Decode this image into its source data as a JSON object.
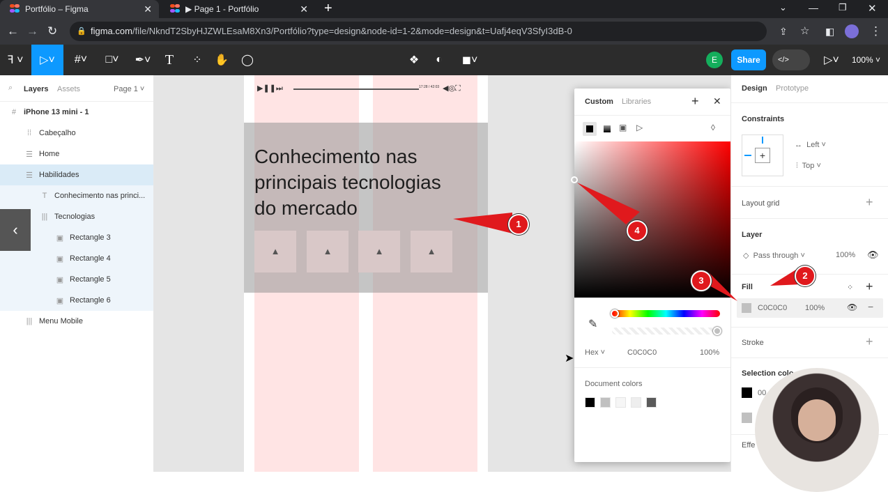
{
  "browser": {
    "tabs": [
      {
        "title": "Portfólio – Figma"
      },
      {
        "title": "▶ Page 1 - Portfólio"
      }
    ],
    "url_host": "figma.com",
    "url_path": "/file/NkndT2SbyHJZWLEsaM8Xn3/Portfólio?type=design&node-id=1-2&mode=design&t=Uafj4eqV3SfyI3dB-0"
  },
  "toolbar": {
    "avatar_initial": "E",
    "share_label": "Share",
    "zoom": "100%"
  },
  "left_panel": {
    "tabs": {
      "layers": "Layers",
      "assets": "Assets",
      "page": "Page 1"
    },
    "layers": [
      {
        "label": "iPhone 13 mini - 1",
        "icon": "#"
      },
      {
        "label": "Cabeçalho",
        "icon": "⁞⁞"
      },
      {
        "label": "Home",
        "icon": "☰"
      },
      {
        "label": "Habilidades",
        "icon": "☰"
      },
      {
        "label": "Conhecimento nas princi...",
        "icon": "T"
      },
      {
        "label": "Tecnologias",
        "icon": "|||"
      },
      {
        "label": "Rectangle 3",
        "icon": "▣"
      },
      {
        "label": "Rectangle 4",
        "icon": "▣"
      },
      {
        "label": "Rectangle 5",
        "icon": "▣"
      },
      {
        "label": "Rectangle 6",
        "icon": "▣"
      },
      {
        "label": "Menu Mobile",
        "icon": "|||"
      }
    ]
  },
  "canvas": {
    "heading_line1": "Conhecimento nas",
    "heading_line2": "principais tecnologias",
    "heading_line3": "do mercado",
    "player_time": "17:28 / 42:03"
  },
  "color_picker": {
    "tab_custom": "Custom",
    "tab_libraries": "Libraries",
    "format": "Hex",
    "hex_value": "C0C0C0",
    "opacity": "100%",
    "document_colors_label": "Document colors",
    "document_colors": [
      "#000000",
      "#c0c0c0",
      "#f6f6f6",
      "#eeeeee",
      "#5a5a5a"
    ]
  },
  "right_panel": {
    "tabs": {
      "design": "Design",
      "prototype": "Prototype"
    },
    "constraints_label": "Constraints",
    "constraint_h": "Left",
    "constraint_v": "Top",
    "layout_grid_label": "Layout grid",
    "layer_label": "Layer",
    "blend_mode": "Pass through",
    "layer_opacity": "100%",
    "fill_label": "Fill",
    "fill_hex": "C0C0C0",
    "fill_opacity": "100%",
    "stroke_label": "Stroke",
    "selection_colors_label": "Selection colo",
    "selection_color_1": "00",
    "effects_label": "Effe"
  },
  "annotations": [
    "1",
    "2",
    "3",
    "4"
  ],
  "colors": {
    "accent_blue": "#0d99ff",
    "annotation_red": "#e0191d",
    "avatar_green": "#14ae5c"
  }
}
